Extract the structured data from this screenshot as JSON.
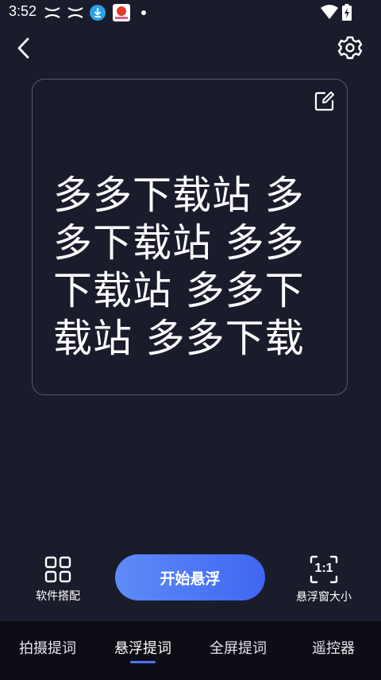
{
  "status_bar": {
    "time": "3:52",
    "icons": [
      "x-icon",
      "x-icon",
      "download-icon",
      "app-notification-icon",
      "dot-icon",
      "wifi-icon",
      "battery-charging-icon"
    ]
  },
  "header": {
    "back_icon": "chevron-left-icon",
    "settings_icon": "gear-icon"
  },
  "script_card": {
    "edit_icon": "edit-icon",
    "text": "多多下载站 多多下载站 多多下载站 多多下载站 多多下载"
  },
  "actions": {
    "app_match_label": "软件搭配",
    "app_match_icon": "grid-icon",
    "start_label": "开始悬浮",
    "float_size_label": "悬浮窗大小",
    "float_size_ratio": "1:1"
  },
  "bottom_nav": {
    "tabs": [
      {
        "label": "拍摄提词",
        "active": false
      },
      {
        "label": "悬浮提词",
        "active": true
      },
      {
        "label": "全屏提词",
        "active": false
      },
      {
        "label": "遥控器",
        "active": false
      }
    ]
  },
  "colors": {
    "background": "#1b1c2b",
    "accent": "#4c74f5",
    "nav_background": "#0d0e15"
  }
}
